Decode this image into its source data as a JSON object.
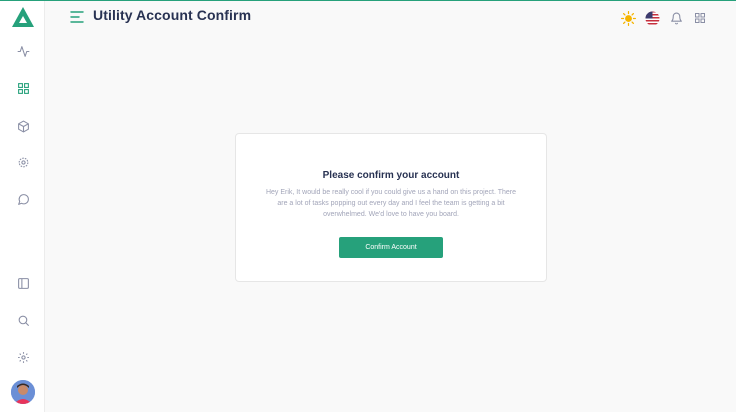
{
  "header": {
    "title": "Utility Account Confirm",
    "icons": [
      "sun-icon",
      "us-flag-icon",
      "bell-icon",
      "apps-grid-icon"
    ]
  },
  "sidebar": {
    "items": [
      {
        "icon": "activity-icon"
      },
      {
        "icon": "grid-icon",
        "active": true
      },
      {
        "icon": "box-icon"
      },
      {
        "icon": "cog-icon"
      },
      {
        "icon": "message-icon"
      },
      {
        "icon": "sidebar-panel-icon"
      },
      {
        "icon": "search-icon"
      },
      {
        "icon": "settings-icon"
      }
    ]
  },
  "card": {
    "title": "Please confirm your account",
    "body": "Hey Erik, It would be really cool if you could give us a hand on this project. There are a lot of tasks popping out every day and I feel the team is getting a bit overwhelmed. We'd love to have you board.",
    "button_label": "Confirm Account"
  },
  "colors": {
    "accent": "#26a17b",
    "title": "#283252",
    "muted": "#a2a5b9",
    "sun": "#f5b400"
  }
}
